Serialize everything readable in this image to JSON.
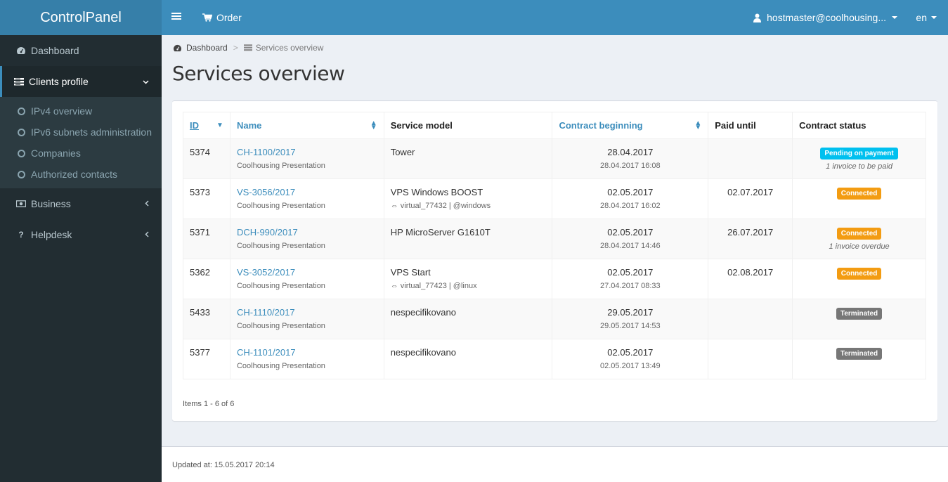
{
  "app": {
    "title": "ControlPanel"
  },
  "topbar": {
    "menu_icon": "hamburger-icon",
    "order_label": "Order",
    "order_icon": "cart-icon",
    "user_label": "hostmaster@coolhousing...",
    "user_icon": "user-icon",
    "language": "en"
  },
  "sidebar": {
    "items": [
      {
        "label": "Dashboard",
        "icon": "dashboard-icon"
      },
      {
        "label": "Clients profile",
        "icon": "list-icon",
        "expanded": true,
        "children": [
          {
            "label": "IPv4 overview"
          },
          {
            "label": "IPv6 subnets administration"
          },
          {
            "label": "Companies"
          },
          {
            "label": "Authorized contacts"
          }
        ]
      },
      {
        "label": "Business",
        "icon": "money-icon"
      },
      {
        "label": "Helpdesk",
        "icon": "question-icon"
      }
    ]
  },
  "breadcrumb": {
    "home": "Dashboard",
    "current": "Services overview"
  },
  "page": {
    "title": "Services overview"
  },
  "table": {
    "columns": [
      {
        "label": "ID",
        "sortable": true,
        "sort": "desc"
      },
      {
        "label": "Name",
        "sortable": true
      },
      {
        "label": "Service model",
        "sortable": false
      },
      {
        "label": "Contract beginning",
        "sortable": true
      },
      {
        "label": "Paid until",
        "sortable": false
      },
      {
        "label": "Contract status",
        "sortable": false
      }
    ],
    "rows": [
      {
        "id": "5374",
        "name": "CH-1100/2017",
        "company": "Coolhousing Presentation",
        "model": "Tower",
        "model_sub": "",
        "begin": "28.04.2017",
        "begin_sub": "28.04.2017 16:08",
        "paid": "",
        "status": "Pending on payment",
        "status_type": "info",
        "note": "1 invoice to be paid"
      },
      {
        "id": "5373",
        "name": "VS-3056/2017",
        "company": "Coolhousing Presentation",
        "model": "VPS Windows BOOST",
        "model_sub": "⇔ virtual_77432 | @windows",
        "begin": "02.05.2017",
        "begin_sub": "28.04.2017 16:02",
        "paid": "02.07.2017",
        "status": "Connected",
        "status_type": "warn",
        "note": ""
      },
      {
        "id": "5371",
        "name": "DCH-990/2017",
        "company": "Coolhousing Presentation",
        "model": "HP MicroServer G1610T",
        "model_sub": "",
        "begin": "02.05.2017",
        "begin_sub": "28.04.2017 14:46",
        "paid": "26.07.2017",
        "status": "Connected",
        "status_type": "warn",
        "note": "1 invoice overdue"
      },
      {
        "id": "5362",
        "name": "VS-3052/2017",
        "company": "Coolhousing Presentation",
        "model": "VPS Start",
        "model_sub": "⇔ virtual_77423 | @linux",
        "begin": "02.05.2017",
        "begin_sub": "27.04.2017 08:33",
        "paid": "02.08.2017",
        "status": "Connected",
        "status_type": "warn",
        "note": ""
      },
      {
        "id": "5433",
        "name": "CH-1110/2017",
        "company": "Coolhousing Presentation",
        "model": "nespecifikovano",
        "model_sub": "",
        "begin": "29.05.2017",
        "begin_sub": "29.05.2017 14:53",
        "paid": "",
        "status": "Terminated",
        "status_type": "gray",
        "note": ""
      },
      {
        "id": "5377",
        "name": "CH-1101/2017",
        "company": "Coolhousing Presentation",
        "model": "nespecifikovano",
        "model_sub": "",
        "begin": "02.05.2017",
        "begin_sub": "02.05.2017 13:49",
        "paid": "",
        "status": "Terminated",
        "status_type": "gray",
        "note": ""
      }
    ],
    "items_info": "Items 1 - 6 of 6"
  },
  "footer": {
    "updated": "Updated at: 15.05.2017 20:14"
  },
  "colors": {
    "header": "#3c8dbc",
    "logo": "#367fa9",
    "sidebar": "#222d32",
    "badge_info": "#00c0ef",
    "badge_warn": "#f39c12",
    "badge_gray": "#777777"
  }
}
